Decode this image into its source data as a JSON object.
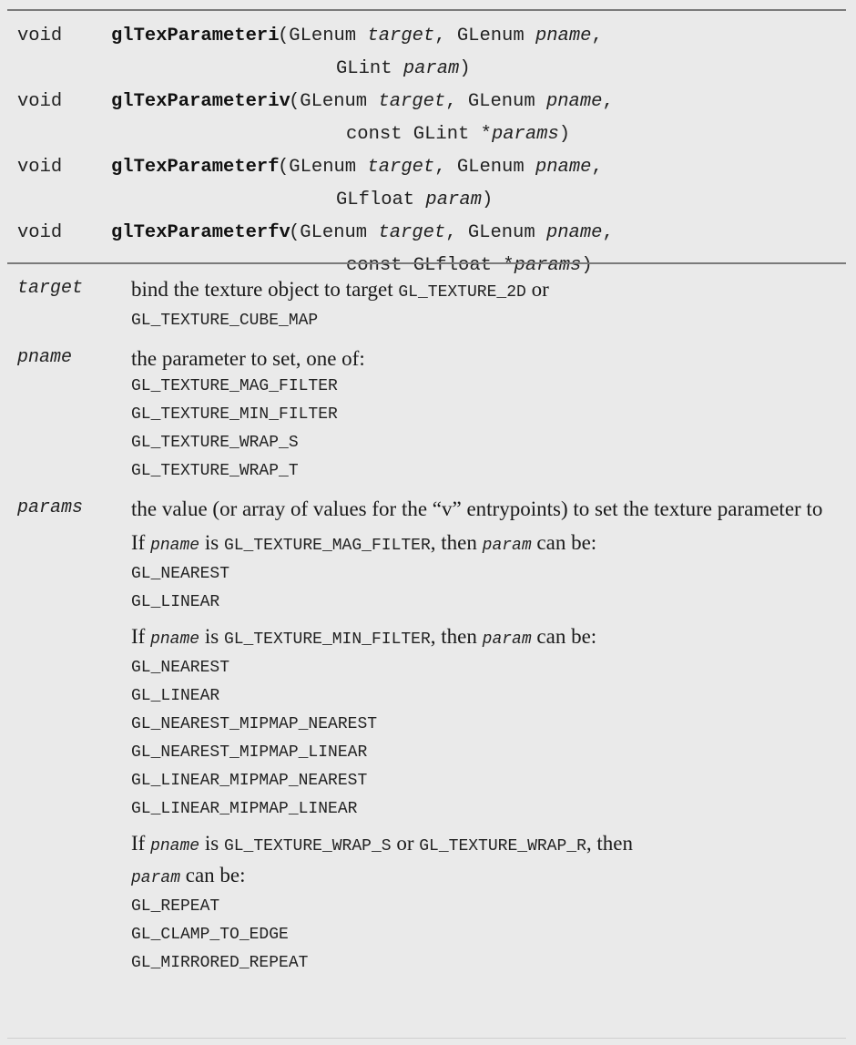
{
  "prototypes": [
    {
      "ret": "void",
      "name": "glTexParameteri",
      "line1": "(GLenum ",
      "t1": "target",
      "m1": ", GLenum ",
      "t2": "pname",
      "e1": ",",
      "line2a": "GLint ",
      "line2b": "param",
      "line2c": ")"
    },
    {
      "ret": "void",
      "name": "glTexParameteriv",
      "line1": "(GLenum ",
      "t1": "target",
      "m1": ", GLenum ",
      "t2": "pname",
      "e1": ",",
      "line2a": "const GLint *",
      "line2b": "params",
      "line2c": ")"
    },
    {
      "ret": "void",
      "name": "glTexParameterf",
      "line1": "(GLenum ",
      "t1": "target",
      "m1": ", GLenum ",
      "t2": "pname",
      "e1": ",",
      "line2a": "GLfloat ",
      "line2b": "param",
      "line2c": ")"
    },
    {
      "ret": "void",
      "name": "glTexParameterfv",
      "line1": "(GLenum ",
      "t1": "target",
      "m1": ", GLenum ",
      "t2": "pname",
      "e1": ",",
      "line2a": "const GLfloat *",
      "line2b": "params",
      "line2c": ")"
    }
  ],
  "target": {
    "name": "target",
    "text1": "bind the texture object to target ",
    "code1": "GL_TEXTURE_2D",
    "text2": " or",
    "code2": "GL_TEXTURE_CUBE_MAP"
  },
  "pname": {
    "name": "pname",
    "text": "the parameter to set, one of:",
    "values": [
      "GL_TEXTURE_MAG_FILTER",
      "GL_TEXTURE_MIN_FILTER",
      "GL_TEXTURE_WRAP_S",
      "GL_TEXTURE_WRAP_T"
    ]
  },
  "params": {
    "name": "params",
    "text": "the value (or array of values for the “v” entrypoints) to set the texture parameter to",
    "groups": [
      {
        "pre": "If ",
        "pname": "pname",
        "is": " is ",
        "code": "GL_TEXTURE_MAG_FILTER",
        "mid": ", then ",
        "param": "param",
        "post": " can be:",
        "values": [
          "GL_NEAREST",
          "GL_LINEAR"
        ]
      },
      {
        "pre": "If ",
        "pname": "pname",
        "is": " is ",
        "code": "GL_TEXTURE_MIN_FILTER",
        "mid": ", then ",
        "param": "param",
        "post": " can be:",
        "values": [
          "GL_NEAREST",
          "GL_LINEAR",
          "GL_NEAREST_MIPMAP_NEAREST",
          "GL_NEAREST_MIPMAP_LINEAR",
          "GL_LINEAR_MIPMAP_NEAREST",
          "GL_LINEAR_MIPMAP_LINEAR"
        ]
      },
      {
        "pre": "If ",
        "pname": "pname",
        "is": " is ",
        "code": "GL_TEXTURE_WRAP_S",
        "or": " or ",
        "code2": "GL_TEXTURE_WRAP_R",
        "mid": ", then",
        "param": "param",
        "post": " can be:",
        "values": [
          "GL_REPEAT",
          "GL_CLAMP_TO_EDGE",
          "GL_MIRRORED_REPEAT"
        ]
      }
    ]
  }
}
